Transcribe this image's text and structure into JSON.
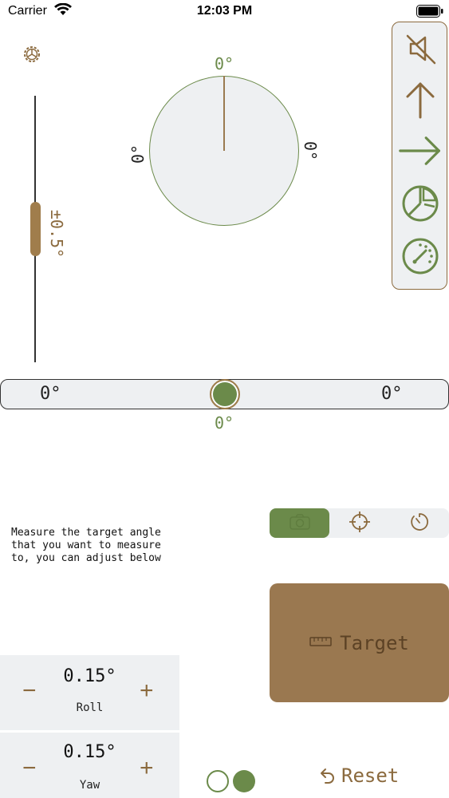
{
  "status_bar": {
    "carrier": "Carrier",
    "time": "12:03 PM"
  },
  "settings": {
    "icon": "gear-icon"
  },
  "tolerance": {
    "label": "±0.5°"
  },
  "dial": {
    "top": "0°",
    "left": "0°",
    "right": "0°"
  },
  "toolbar": {
    "items": [
      {
        "icon": "mute-icon"
      },
      {
        "icon": "arrow-up-icon"
      },
      {
        "icon": "arrow-right-icon"
      },
      {
        "icon": "pie-chart-icon"
      },
      {
        "icon": "gauge-icon"
      }
    ]
  },
  "horizontal_level": {
    "left": "0°",
    "right": "0°",
    "bottom": "0°"
  },
  "instructions": "Measure the target angle\nthat you want to measure\nto, you can adjust below",
  "mode_tabs": [
    {
      "icon": "camera-icon",
      "active": true
    },
    {
      "icon": "crosshair-icon",
      "active": false
    },
    {
      "icon": "timer-icon",
      "active": false
    }
  ],
  "target_button": {
    "label": "Target",
    "icon": "ruler-icon"
  },
  "steppers": {
    "roll": {
      "value": "0.15°",
      "label": "Roll",
      "minus": "−",
      "plus": "+"
    },
    "yaw": {
      "value": "0.15°",
      "label": "Yaw",
      "minus": "−",
      "plus": "+"
    }
  },
  "reset": {
    "label": "Reset",
    "icon": "undo-icon"
  },
  "colors": {
    "green": "#6b8a4a",
    "brown": "#9a7850",
    "panel": "#eef0f2"
  }
}
